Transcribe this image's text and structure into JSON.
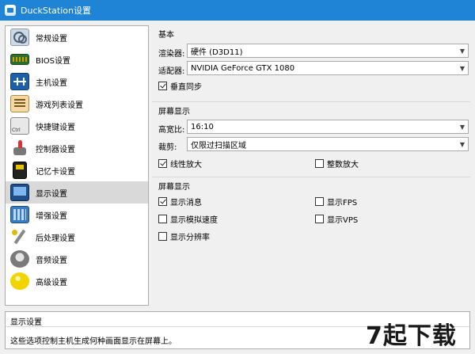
{
  "window": {
    "title": "DuckStation设置"
  },
  "sidebar": {
    "items": [
      {
        "label": "常规设置",
        "icon": "general-settings-icon"
      },
      {
        "label": "BIOS设置",
        "icon": "bios-chip-icon"
      },
      {
        "label": "主机设置",
        "icon": "console-icon"
      },
      {
        "label": "游戏列表设置",
        "icon": "game-list-icon"
      },
      {
        "label": "快捷键设置",
        "icon": "hotkey-icon"
      },
      {
        "label": "控制器设置",
        "icon": "controller-icon"
      },
      {
        "label": "记忆卡设置",
        "icon": "memory-card-icon"
      },
      {
        "label": "显示设置",
        "icon": "display-icon",
        "selected": true
      },
      {
        "label": "增强设置",
        "icon": "enhancement-icon"
      },
      {
        "label": "后处理设置",
        "icon": "post-processing-icon"
      },
      {
        "label": "音频设置",
        "icon": "audio-icon"
      },
      {
        "label": "高级设置",
        "icon": "advanced-icon"
      }
    ]
  },
  "basic": {
    "title": "基本",
    "renderer_label": "渲染器:",
    "renderer_value": "硬件 (D3D11)",
    "adapter_label": "适配器:",
    "adapter_value": "NVIDIA GeForce GTX 1080",
    "vsync_label": "垂直同步",
    "vsync_checked": true
  },
  "screen": {
    "title": "屏幕显示",
    "aspect_label": "高宽比:",
    "aspect_value": "16:10",
    "crop_label": "裁剪:",
    "crop_value": "仅限过扫描区域",
    "linear_label": "线性放大",
    "linear_checked": true,
    "integer_label": "整数放大",
    "integer_checked": false
  },
  "osd": {
    "title": "屏幕显示",
    "show_messages_label": "显示消息",
    "show_messages_checked": true,
    "show_fps_label": "显示FPS",
    "show_fps_checked": false,
    "show_speed_label": "显示模拟速度",
    "show_speed_checked": false,
    "show_vps_label": "显示VPS",
    "show_vps_checked": false,
    "show_resolution_label": "显示分辨率",
    "show_resolution_checked": false
  },
  "description": {
    "title": "显示设置",
    "text": "这些选项控制主机生成何种画面显示在屏幕上。"
  },
  "watermark": {
    "text": "7起下载"
  }
}
